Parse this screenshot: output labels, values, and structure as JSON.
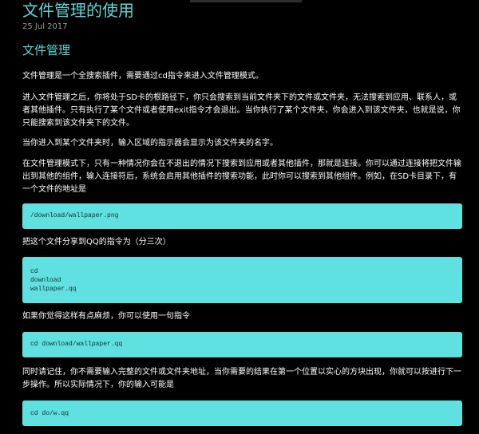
{
  "post": {
    "title": "文件管理的使用",
    "date": "25 Jul 2017"
  },
  "section": {
    "heading": "文件管理"
  },
  "paragraphs": [
    "文件管理是一个全搜索插件，需要通过cd指令来进入文件管理模式。",
    "进入文件管理之后，你将处于SD卡的根路径下，你只会搜索到当前文件夹下的文件或文件夹，无法搜索到应用、联系人，或者其他插件。只有执行了某个文件或者使用exit指令才会退出。当你执行了某个文件夹，你会进入到该文件夹，也就是说，你只能搜索到该文件夹下的文件。",
    "当你进入到某个文件夹时，输入区域的指示器会显示为该文件夹的名字。",
    "在文件管理模式下，只有一种情况你会在不退出的情况下搜索到应用或者其他插件，那就是连接。你可以通过连接将把文件输出到其他的组件，输入连接符后，系统会启用其他插件的搜索功能，此时你可以搜索到其他组件。例如，在SD卡目录下，有一个文件的地址是",
    "把这个文件分享到QQ的指令为（分三次）",
    "如果你觉得这样有点麻烦，你可以使用一句指令",
    "同时请记住，你不需要输入完整的文件或文件夹地址，当你需要的结果在第一个位置以实心的方块出现，你就可以按进行下一步操作。所以实际情况下，你的输入可能是"
  ],
  "code_blocks": [
    {
      "lines": [
        "/download/wallpaper.png"
      ]
    },
    {
      "lines": [
        "cd",
        "download",
        "wallpaper.qq"
      ]
    },
    {
      "lines": [
        "cd download/wallpaper.qq"
      ]
    },
    {
      "lines": [
        "cd do/w.qq"
      ]
    }
  ],
  "colors": {
    "background": "#000000",
    "accent": "#5ad8d8",
    "code_background": "#5fe1e1",
    "code_text": "#1e2a2a"
  }
}
